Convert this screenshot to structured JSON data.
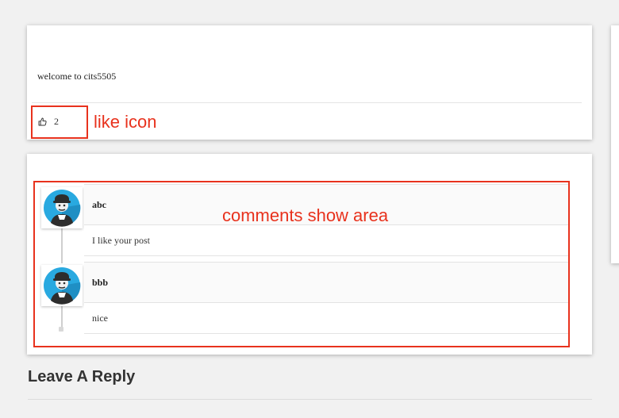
{
  "post": {
    "text": "welcome to cits5505",
    "like_count": "2"
  },
  "comments": [
    {
      "author": "abc",
      "text": "I like your post"
    },
    {
      "author": "bbb",
      "text": "nice"
    }
  ],
  "annotations": {
    "like_label": "like icon",
    "comments_label": "comments show area",
    "color": "#e8321d"
  },
  "reply": {
    "title": "Leave A Reply"
  },
  "icons": {
    "like": "thumbs-up-icon",
    "avatar": "user-avatar"
  }
}
